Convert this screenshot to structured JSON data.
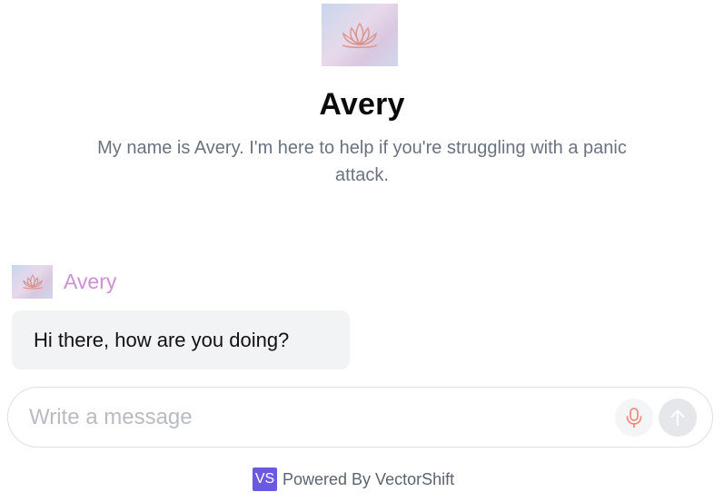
{
  "bot": {
    "name": "Avery",
    "description": "My name is Avery. I'm here to help if you're struggling with a panic attack.",
    "avatar_icon": "lotus-icon"
  },
  "conversation": {
    "messages": [
      {
        "sender": "Avery",
        "text": "Hi there, how are you doing?"
      }
    ]
  },
  "composer": {
    "placeholder": "Write a message",
    "value": "",
    "mic_icon": "microphone-icon",
    "send_icon": "arrow-up-icon"
  },
  "footer": {
    "logo_text": "VS",
    "text": "Powered By VectorShift"
  },
  "colors": {
    "sender_name": "#cf8fd3",
    "mic": "#f08c84",
    "logo_bg": "#6a5ae0"
  }
}
